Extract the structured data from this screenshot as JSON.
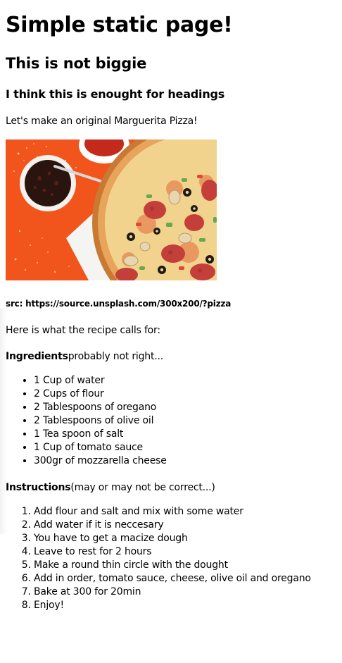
{
  "headings": {
    "h1": "Simple static page!",
    "h2": "This is not biggie",
    "h3": "I think this is enought for headings"
  },
  "intro": "Let's make an original Marguerita Pizza!",
  "image": {
    "alt": "Pizza",
    "description_icon": "pizza-photo"
  },
  "source_caption": "src: https://source.unsplash.com/300x200/?pizza",
  "recipe_intro": "Here is what the recipe calls for:",
  "ingredients": {
    "label": "Ingredients",
    "note": "probably not right...",
    "items": [
      "1 Cup of water",
      "2 Cups of flour",
      "2 Tablespoons of oregano",
      "2 Tablespoons of olive oil",
      "1 Tea spoon of salt",
      "1 Cup of tomato sauce",
      "300gr of mozzarella cheese"
    ]
  },
  "instructions": {
    "label": "Instructions",
    "note": "(may or may not be correct...)",
    "steps": [
      "Add flour and salt and mix with some water",
      "Add water if it is neccesary",
      "You have to get a macize dough",
      "Leave to rest for 2 hours",
      "Make a round thin circle with the dought",
      "Add in order, tomato sauce, cheese, olive oil and oregano",
      "Bake at 300 for 20min",
      "Enjoy!"
    ]
  },
  "colors": {
    "orange_bg": "#f2551c",
    "white_board": "#f4f4f2",
    "crust": "#d68a3c",
    "cheese": "#f3d58f",
    "pepperoni": "#c8403a",
    "olive": "#1e1a16",
    "green_pepper": "#6aa84f"
  }
}
